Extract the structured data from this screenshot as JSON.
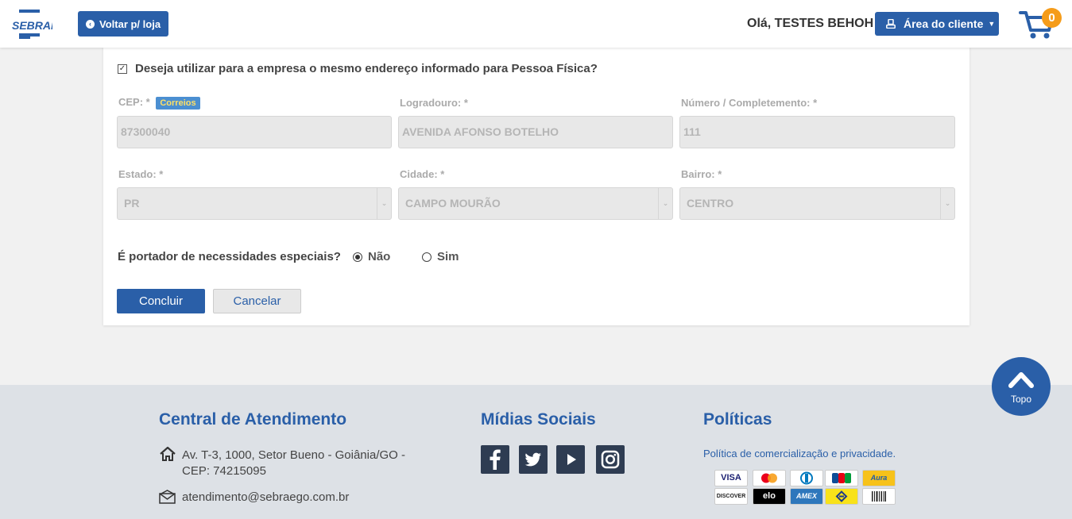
{
  "header": {
    "logo_text": "SEBRAE",
    "back_label": "Voltar p/ loja",
    "greeting": "Olá, TESTES BEHOH",
    "client_area_label": "Área do cliente",
    "cart_count": "0",
    "brand_color": "#2a5fa8",
    "badge_color": "#f59c1a"
  },
  "form": {
    "same_address_label": "Deseja utilizar para a empresa o mesmo endereço informado para Pessoa Física?",
    "same_address_checked": true,
    "cep_label": "CEP: *",
    "correios_label": "Correios",
    "cep_value": "87300040",
    "logradouro_label": "Logradouro: *",
    "logradouro_value": "AVENIDA AFONSO BOTELHO",
    "numero_label": "Número / Completemento: *",
    "numero_value": "111",
    "estado_label": "Estado: *",
    "estado_value": "PR",
    "cidade_label": "Cidade: *",
    "cidade_value": "CAMPO MOURÃO",
    "bairro_label": "Bairro: *",
    "bairro_value": "CENTRO",
    "special_needs_question": "É portador de necessidades especiais?",
    "option_no": "Não",
    "option_yes": "Sim",
    "selected_option": "Não",
    "submit_label": "Concluir",
    "cancel_label": "Cancelar"
  },
  "top_button_label": "Topo",
  "footer": {
    "contact_title": "Central de Atendimento",
    "address": "Av. T-3, 1000, Setor Bueno - Goiânia/GO - CEP: 74215095",
    "email": "atendimento@sebraego.com.br",
    "social_title": "Mídias Sociais",
    "social_icons": [
      "facebook-icon",
      "twitter-icon",
      "youtube-icon",
      "instagram-icon"
    ],
    "policies_title": "Políticas",
    "policies_link": "Política de comercialização e privacidade.",
    "payment_methods": [
      "VISA",
      "Mastercard",
      "Diners",
      "JCB",
      "Aura",
      "DISCOVER",
      "elo",
      "AMEX",
      "Banco do Brasil",
      "Boleto"
    ]
  }
}
